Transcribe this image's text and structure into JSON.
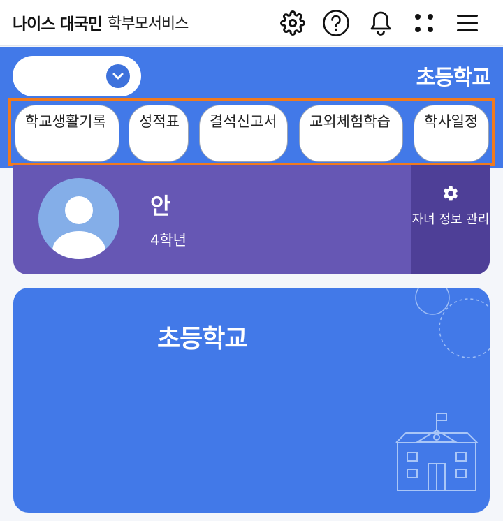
{
  "app": {
    "brand": "나이스 대국민",
    "service": "학부모서비스"
  },
  "toolbar": {
    "icons": [
      "gear-icon",
      "help-icon",
      "bell-icon",
      "apps-icon",
      "menu-icon"
    ]
  },
  "school_select": {
    "value": ""
  },
  "header": {
    "school_name": "초등학교"
  },
  "chips": [
    {
      "label": "학교생활기록"
    },
    {
      "label": "성적표"
    },
    {
      "label": "결석신고서"
    },
    {
      "label": "교외체험학습"
    },
    {
      "label": "학사일정"
    }
  ],
  "child": {
    "name": "안",
    "grade": "4학년",
    "manage_label": "자녀 정보 관리"
  },
  "school_card": {
    "name": "초등학교"
  },
  "colors": {
    "primary": "#4279e8",
    "child_card": "#6657b4",
    "child_card_dark": "#4e3f97",
    "highlight": "#f07a1e",
    "avatar": "#84aee8"
  }
}
